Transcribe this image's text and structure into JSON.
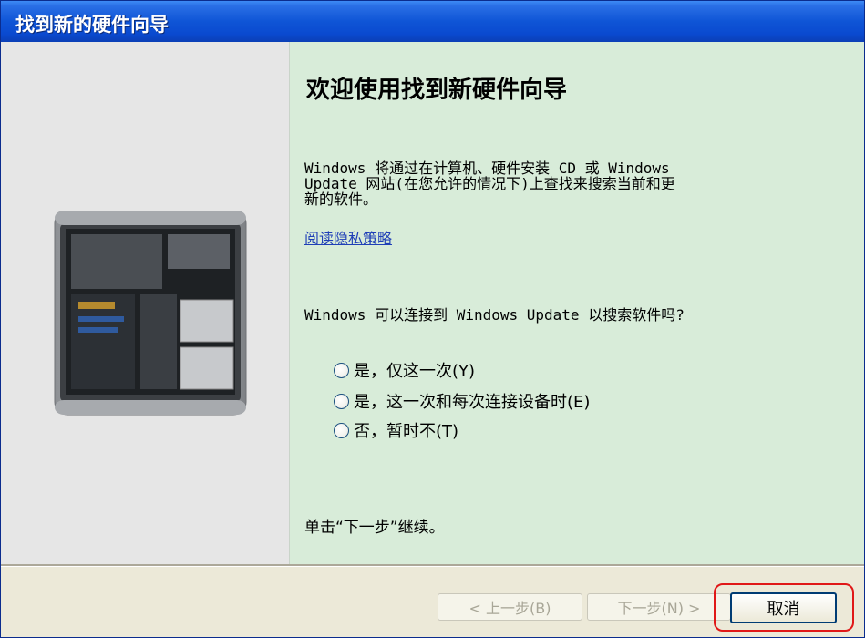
{
  "window": {
    "title": "找到新的硬件向导"
  },
  "wizard": {
    "heading": "欢迎使用找到新硬件向导",
    "description_lines": [
      "Windows 将通过在计算机、硬件安装 CD 或 Windows",
      "Update 网站(在您允许的情况下)上查找来搜索当前和更",
      "新的软件。"
    ],
    "privacy_link": "阅读隐私策略",
    "question": "Windows 可以连接到 Windows Update 以搜索软件吗?",
    "options": [
      {
        "label": "是，仅这一次(Y)",
        "selected": false
      },
      {
        "label": "是，这一次和每次连接设备时(E)",
        "selected": false
      },
      {
        "label": "否，暂时不(T)",
        "selected": false
      }
    ],
    "hint": "单击“下一步”继续。"
  },
  "buttons": {
    "back": "< 上一步(B)",
    "next": "下一步(N) >",
    "cancel": "取消"
  },
  "colors": {
    "titlebar": "#0a4ad0",
    "content_bg": "#d8ecd9",
    "left_panel_bg": "#e6e6e6",
    "highlight": "#e01818",
    "link": "#1f3fb7"
  },
  "icons": {
    "hero_image": "computer-tower-icon",
    "radio": "radio-button-icon"
  }
}
